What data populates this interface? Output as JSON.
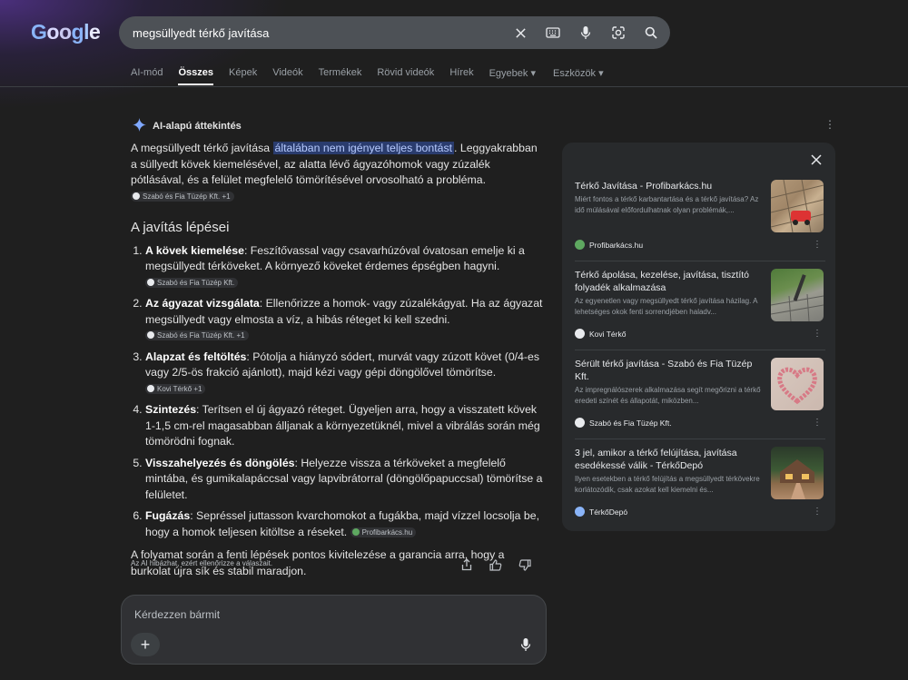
{
  "header": {
    "logo": "Google",
    "search_value": "megsüllyedt térkő javítása"
  },
  "tabs": [
    {
      "label": "AI-mód"
    },
    {
      "label": "Összes",
      "active": true
    },
    {
      "label": "Képek"
    },
    {
      "label": "Videók"
    },
    {
      "label": "Termékek"
    },
    {
      "label": "Rövid videók"
    },
    {
      "label": "Hírek"
    },
    {
      "label": "Egyebek ▾"
    },
    {
      "label": "Eszközök ▾"
    }
  ],
  "ai": {
    "header": "AI-alapú áttekintés",
    "intro_before": "A megsüllyedt térkő javítása ",
    "intro_highlight": "általában nem igényel teljes bontást",
    "intro_after": ". Leggyakrabban a süllyedt kövek kiemelésével, az alatta lévő ágyazóhomok vagy zúzalék pótlásával, és a felület megfelelő tömörítésével orvosolható a probléma.",
    "intro_chip": "Szabó és Fia Tüzép Kft. +1",
    "heading": "A javítás lépései",
    "steps": [
      {
        "bold": "A kövek kiemelése",
        "text": ": Feszítővassal vagy csavarhúzóval óvatosan emelje ki a megsüllyedt térköveket. A környező köveket érdemes épségben hagyni.",
        "chip": "Szabó és Fia Tüzép Kft."
      },
      {
        "bold": "Az ágyazat vizsgálata",
        "text": ": Ellenőrizze a homok- vagy zúzalékágyat. Ha az ágyazat megsüllyedt vagy elmosta a víz, a hibás réteget ki kell szedni.",
        "chip": "Szabó és Fia Tüzép Kft. +1"
      },
      {
        "bold": "Alapzat és feltöltés",
        "text": ": Pótolja a hiányzó sódert, murvát vagy zúzott követ (0/4-es vagy 2/5-ös frakció ajánlott), majd kézi vagy gépi döngölővel tömörítse.",
        "chip": "Kovi Térkő +1"
      },
      {
        "bold": "Szintezés",
        "text": ": Terítsen el új ágyazó réteget. Ügyeljen arra, hogy a visszatett kövek 1-1,5 cm-rel magasabban álljanak a környezetüknél, mivel a vibrálás során még tömörödni fognak.",
        "chip": ""
      },
      {
        "bold": "Visszahelyezés és döngölés",
        "text": ": Helyezze vissza a térköveket a megfelelő mintába, és gumikalapáccsal vagy lapvibrátorral (döngölőpapuccsal) tömörítse a felületet.",
        "chip": ""
      },
      {
        "bold": "Fugázás",
        "text": ": Sepréssel juttasson kvarchomokot a fugákba, majd vízzel locsolja be, hogy a homok teljesen kitöltse a réseket.",
        "chip": "Profibarkács.hu"
      }
    ],
    "closing": "A folyamat során a fenti lépések pontos kivitelezése a garancia arra, hogy a burkolat újra sík és stabil maradjon.",
    "disclaimer": "Az AI hibázhat, ezért ellenőrizze a válaszait."
  },
  "sources": [
    {
      "title": "Térkő Javítása - Profibarkács.hu",
      "desc": "Miért fontos a térkő karbantartása és a térkő javítása? Az idő múlásával előfordulhatnak olyan problémák,...",
      "site": "Profibarkács.hu",
      "favicon_color": "#5ea860"
    },
    {
      "title": "Térkő ápolása, kezelése, javítása, tisztító folyadék alkalmazása",
      "desc": "Az egyenetlen vagy megsüllyedt térkő javítása házilag. A lehetséges okok fenti sorrendjében haladv...",
      "site": "Kovi Térkő",
      "favicon_color": "#e8eaed"
    },
    {
      "title": "Sérült térkő javítása - Szabó és Fia Tüzép Kft.",
      "desc": "Az impregnálószerek alkalmazása segít megőrizni a térkő eredeti színét és állapotát, miközben...",
      "site": "Szabó és Fia Tüzép Kft.",
      "favicon_color": "#e8eaed"
    },
    {
      "title": "3 jel, amikor a térkő felújítása, javítása esedékessé válik - TérkőDepó",
      "desc": "Ilyen esetekben a térkő felújítás a megsüllyedt térkövekre korlátozódik, csak azokat kell kiemelni és...",
      "site": "TérkőDepó",
      "favicon_color": "#8ab4f8"
    }
  ],
  "ask": {
    "placeholder": "Kérdezzen bármit"
  }
}
